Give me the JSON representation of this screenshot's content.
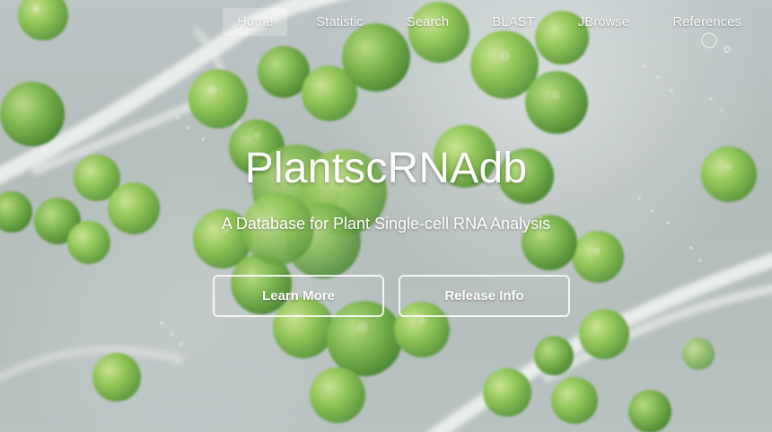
{
  "nav": {
    "items": [
      "Home",
      "Statistic",
      "Search",
      "BLAST",
      "JBrowse",
      "References"
    ],
    "active": "Home"
  },
  "hero": {
    "title": "PlantscRNAdb",
    "subtitle": "A Database for Plant Single-cell RNA Analysis",
    "buttons": {
      "learn_more": "Learn More",
      "release_info": "Release Info"
    }
  },
  "colors": {
    "background": "#b7c2c0",
    "cell_green": "#6aa83a",
    "text": "#ffffff"
  }
}
